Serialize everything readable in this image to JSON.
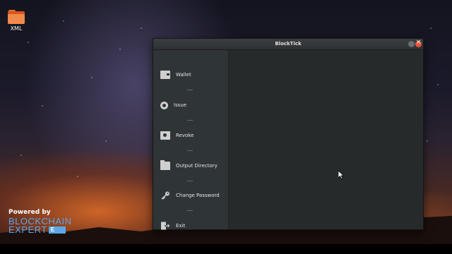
{
  "desktop": {
    "icon_label": "XML",
    "brand": {
      "powered_by": "Powered by",
      "line1": "BLOCKCHAIN",
      "line2": "EXPERT"
    }
  },
  "window": {
    "title": "BlockTick",
    "menu": [
      {
        "label": "Wallet",
        "icon": "wallet-icon"
      },
      {
        "label": "Issue",
        "icon": "gear-icon"
      },
      {
        "label": "Revoke",
        "icon": "certificate-icon"
      },
      {
        "label": "Output Directory",
        "icon": "folder-icon"
      },
      {
        "label": "Change Password",
        "icon": "key-icon"
      },
      {
        "label": "Exit",
        "icon": "exit-icon"
      }
    ],
    "separator": "----"
  },
  "colors": {
    "accent_close": "#e9553a",
    "brand_blue": "#5aa8e8",
    "sidebar_bg": "#2f3436",
    "content_bg": "#262a2b"
  }
}
